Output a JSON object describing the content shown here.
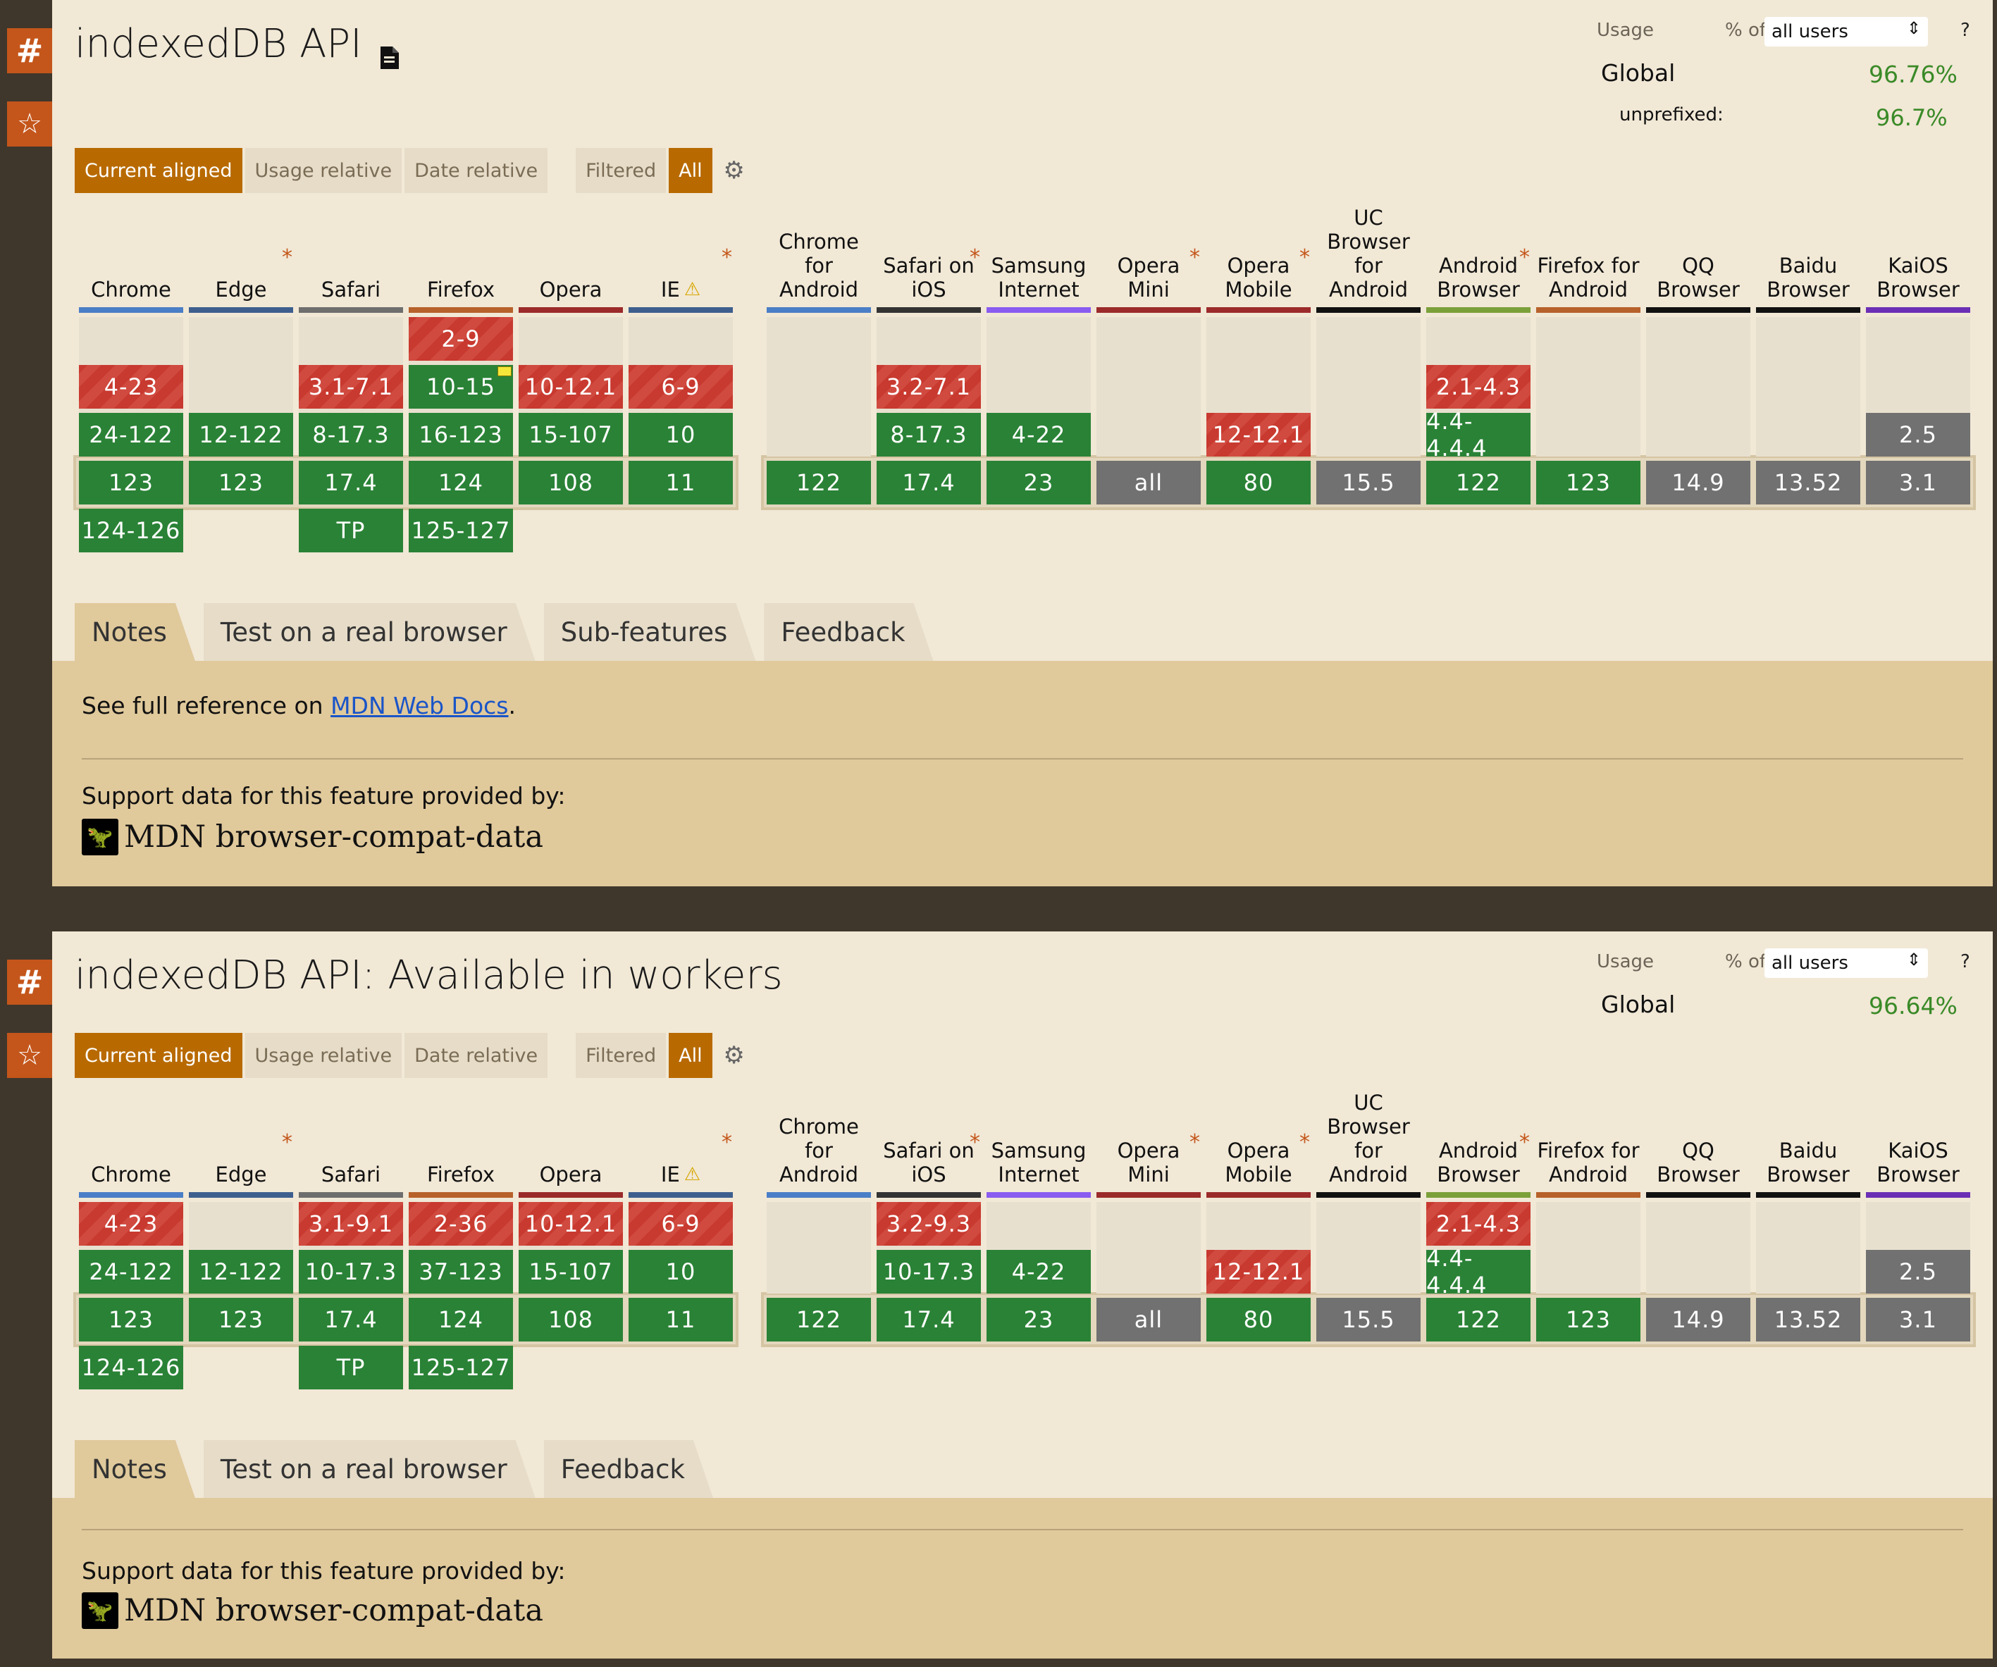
{
  "features": [
    {
      "title": "indexedDB API",
      "has_doc_icon": true,
      "usage": {
        "label": "Usage",
        "pct_of": "% of",
        "selected": "all users",
        "help": "?",
        "global_label": "Global",
        "global_value": "96.76%",
        "unprefixed_label": "unprefixed:",
        "unprefixed_value": "96.7%"
      },
      "buttons": {
        "current": "Current aligned",
        "usage": "Usage relative",
        "date": "Date relative",
        "filtered": "Filtered",
        "all": "All"
      },
      "tabs": [
        "Notes",
        "Test on a real browser",
        "Sub-features",
        "Feedback"
      ],
      "ref_text": "See full reference on ",
      "ref_link": "MDN Web Docs",
      "ref_end": ".",
      "support_label": "Support data for this feature provided by:",
      "support_source": "MDN browser-compat-data"
    },
    {
      "title": "indexedDB API: Available in workers",
      "has_doc_icon": false,
      "usage": {
        "label": "Usage",
        "pct_of": "% of",
        "selected": "all users",
        "help": "?",
        "global_label": "Global",
        "global_value": "96.64%"
      },
      "buttons": {
        "current": "Current aligned",
        "usage": "Usage relative",
        "date": "Date relative",
        "filtered": "Filtered",
        "all": "All"
      },
      "tabs": [
        "Notes",
        "Test on a real browser",
        "Feedback"
      ],
      "support_label": "Support data for this feature provided by:",
      "support_source": "MDN browser-compat-data"
    }
  ],
  "browsers": [
    {
      "id": "chrome",
      "name": "Chrome",
      "color": "#4a7ec6",
      "star": false
    },
    {
      "id": "edge",
      "name": "Edge",
      "color": "#3e5f8e",
      "star": true
    },
    {
      "id": "safari",
      "name": "Safari",
      "color": "#6e6e6e",
      "star": false
    },
    {
      "id": "firefox",
      "name": "Firefox",
      "color": "#b7612b",
      "star": false
    },
    {
      "id": "opera",
      "name": "Opera",
      "color": "#9b2a2a",
      "star": false
    },
    {
      "id": "ie",
      "name": "IE",
      "color": "#3e5f8e",
      "star": true,
      "warn": true
    },
    {
      "id": "chrome-android",
      "name": "Chrome for Android",
      "color": "#4a7ec6",
      "star": false
    },
    {
      "id": "safari-ios",
      "name": "Safari on iOS",
      "color": "#333333",
      "star": true
    },
    {
      "id": "samsung",
      "name": "Samsung Internet",
      "color": "#8a5cf0",
      "star": false
    },
    {
      "id": "opera-mini",
      "name": "Opera Mini",
      "color": "#9b2a2a",
      "star": true
    },
    {
      "id": "opera-mobile",
      "name": "Opera Mobile",
      "color": "#9b2a2a",
      "star": true
    },
    {
      "id": "uc",
      "name": "UC Browser for Android",
      "color": "#111111",
      "star": false
    },
    {
      "id": "android",
      "name": "Android Browser",
      "color": "#7ba03a",
      "star": true
    },
    {
      "id": "firefox-android",
      "name": "Firefox for Android",
      "color": "#b7612b",
      "star": false
    },
    {
      "id": "qq",
      "name": "QQ Browser",
      "color": "#111111",
      "star": false
    },
    {
      "id": "baidu",
      "name": "Baidu Browser",
      "color": "#111111",
      "star": false
    },
    {
      "id": "kaios",
      "name": "KaiOS Browser",
      "color": "#6b2fb5",
      "star": false
    }
  ],
  "support_tables": [
    {
      "chrome": [
        {
          "row": 1,
          "v": "4-23",
          "s": "r"
        },
        {
          "row": 2,
          "v": "24-122",
          "s": "g"
        },
        {
          "row": 3,
          "v": "123",
          "s": "g"
        },
        {
          "row": 4,
          "v": "124-126",
          "s": "g"
        }
      ],
      "edge": [
        {
          "row": 2,
          "v": "12-122",
          "s": "g"
        },
        {
          "row": 3,
          "v": "123",
          "s": "g"
        }
      ],
      "safari": [
        {
          "row": 1,
          "v": "3.1-7.1",
          "s": "r"
        },
        {
          "row": 2,
          "v": "8-17.3",
          "s": "g"
        },
        {
          "row": 3,
          "v": "17.4",
          "s": "g"
        },
        {
          "row": 4,
          "v": "TP",
          "s": "g"
        }
      ],
      "firefox": [
        {
          "row": 0,
          "v": "2-9",
          "s": "r"
        },
        {
          "row": 1,
          "v": "10-15",
          "s": "g",
          "note": true
        },
        {
          "row": 2,
          "v": "16-123",
          "s": "g"
        },
        {
          "row": 3,
          "v": "124",
          "s": "g"
        },
        {
          "row": 4,
          "v": "125-127",
          "s": "g"
        }
      ],
      "opera": [
        {
          "row": 1,
          "v": "10-12.1",
          "s": "r"
        },
        {
          "row": 2,
          "v": "15-107",
          "s": "g"
        },
        {
          "row": 3,
          "v": "108",
          "s": "g"
        }
      ],
      "ie": [
        {
          "row": 1,
          "v": "6-9",
          "s": "r"
        },
        {
          "row": 2,
          "v": "10",
          "s": "g"
        },
        {
          "row": 3,
          "v": "11",
          "s": "g"
        }
      ],
      "chrome-android": [
        {
          "row": 3,
          "v": "122",
          "s": "g"
        }
      ],
      "safari-ios": [
        {
          "row": 1,
          "v": "3.2-7.1",
          "s": "r"
        },
        {
          "row": 2,
          "v": "8-17.3",
          "s": "g"
        },
        {
          "row": 3,
          "v": "17.4",
          "s": "g"
        }
      ],
      "samsung": [
        {
          "row": 2,
          "v": "4-22",
          "s": "g"
        },
        {
          "row": 3,
          "v": "23",
          "s": "g"
        }
      ],
      "opera-mini": [
        {
          "row": 3,
          "v": "all",
          "s": "gr"
        }
      ],
      "opera-mobile": [
        {
          "row": 2,
          "v": "12-12.1",
          "s": "r"
        },
        {
          "row": 3,
          "v": "80",
          "s": "g"
        }
      ],
      "uc": [
        {
          "row": 3,
          "v": "15.5",
          "s": "gr"
        }
      ],
      "android": [
        {
          "row": 1,
          "v": "2.1-4.3",
          "s": "r"
        },
        {
          "row": 2,
          "v": "4.4-4.4.4",
          "s": "g"
        },
        {
          "row": 3,
          "v": "122",
          "s": "g"
        }
      ],
      "firefox-android": [
        {
          "row": 3,
          "v": "123",
          "s": "g"
        }
      ],
      "qq": [
        {
          "row": 3,
          "v": "14.9",
          "s": "gr"
        }
      ],
      "baidu": [
        {
          "row": 3,
          "v": "13.52",
          "s": "gr"
        }
      ],
      "kaios": [
        {
          "row": 2,
          "v": "2.5",
          "s": "gr"
        },
        {
          "row": 3,
          "v": "3.1",
          "s": "gr"
        }
      ]
    },
    {
      "chrome": [
        {
          "row": 1,
          "v": "4-23",
          "s": "r"
        },
        {
          "row": 2,
          "v": "24-122",
          "s": "g"
        },
        {
          "row": 3,
          "v": "123",
          "s": "g"
        },
        {
          "row": 4,
          "v": "124-126",
          "s": "g"
        }
      ],
      "edge": [
        {
          "row": 2,
          "v": "12-122",
          "s": "g"
        },
        {
          "row": 3,
          "v": "123",
          "s": "g"
        }
      ],
      "safari": [
        {
          "row": 1,
          "v": "3.1-9.1",
          "s": "r"
        },
        {
          "row": 2,
          "v": "10-17.3",
          "s": "g"
        },
        {
          "row": 3,
          "v": "17.4",
          "s": "g"
        },
        {
          "row": 4,
          "v": "TP",
          "s": "g"
        }
      ],
      "firefox": [
        {
          "row": 1,
          "v": "2-36",
          "s": "r"
        },
        {
          "row": 2,
          "v": "37-123",
          "s": "g"
        },
        {
          "row": 3,
          "v": "124",
          "s": "g"
        },
        {
          "row": 4,
          "v": "125-127",
          "s": "g"
        }
      ],
      "opera": [
        {
          "row": 1,
          "v": "10-12.1",
          "s": "r"
        },
        {
          "row": 2,
          "v": "15-107",
          "s": "g"
        },
        {
          "row": 3,
          "v": "108",
          "s": "g"
        }
      ],
      "ie": [
        {
          "row": 1,
          "v": "6-9",
          "s": "r"
        },
        {
          "row": 2,
          "v": "10",
          "s": "g"
        },
        {
          "row": 3,
          "v": "11",
          "s": "g"
        }
      ],
      "chrome-android": [
        {
          "row": 3,
          "v": "122",
          "s": "g"
        }
      ],
      "safari-ios": [
        {
          "row": 1,
          "v": "3.2-9.3",
          "s": "r"
        },
        {
          "row": 2,
          "v": "10-17.3",
          "s": "g"
        },
        {
          "row": 3,
          "v": "17.4",
          "s": "g"
        }
      ],
      "samsung": [
        {
          "row": 2,
          "v": "4-22",
          "s": "g"
        },
        {
          "row": 3,
          "v": "23",
          "s": "g"
        }
      ],
      "opera-mini": [
        {
          "row": 3,
          "v": "all",
          "s": "gr"
        }
      ],
      "opera-mobile": [
        {
          "row": 2,
          "v": "12-12.1",
          "s": "r"
        },
        {
          "row": 3,
          "v": "80",
          "s": "g"
        }
      ],
      "uc": [
        {
          "row": 3,
          "v": "15.5",
          "s": "gr"
        }
      ],
      "android": [
        {
          "row": 1,
          "v": "2.1-4.3",
          "s": "r"
        },
        {
          "row": 2,
          "v": "4.4-4.4.4",
          "s": "g"
        },
        {
          "row": 3,
          "v": "122",
          "s": "g"
        }
      ],
      "firefox-android": [
        {
          "row": 3,
          "v": "123",
          "s": "g"
        }
      ],
      "qq": [
        {
          "row": 3,
          "v": "14.9",
          "s": "gr"
        }
      ],
      "baidu": [
        {
          "row": 3,
          "v": "13.52",
          "s": "gr"
        }
      ],
      "kaios": [
        {
          "row": 2,
          "v": "2.5",
          "s": "gr"
        },
        {
          "row": 3,
          "v": "3.1",
          "s": "gr"
        }
      ]
    }
  ]
}
